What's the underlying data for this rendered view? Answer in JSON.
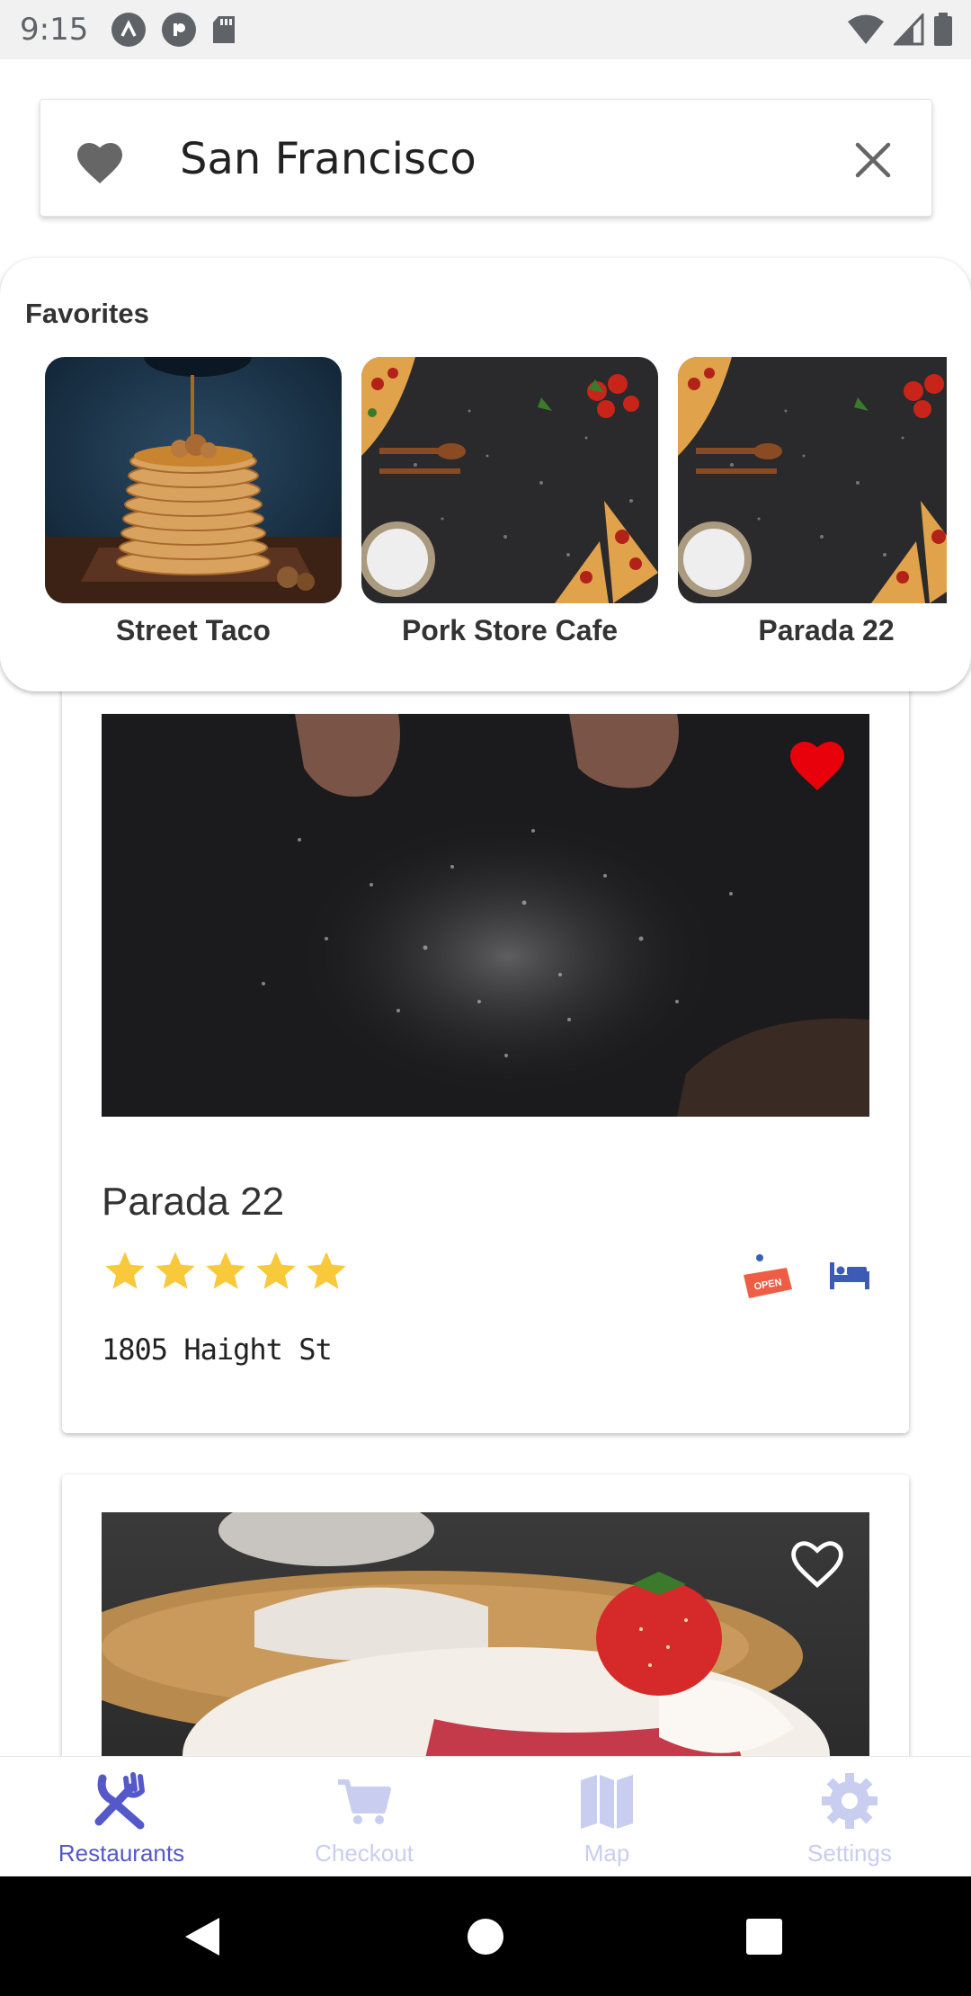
{
  "status_bar": {
    "time": "9:15"
  },
  "search": {
    "query": "San Francisco"
  },
  "favorites": {
    "title": "Favorites",
    "items": [
      {
        "name": "Street Taco"
      },
      {
        "name": "Pork Store Cafe"
      },
      {
        "name": "Parada 22"
      }
    ]
  },
  "restaurants": [
    {
      "name": "Parada 22",
      "rating": 5,
      "address": "1805 Haight St",
      "favorited": true,
      "open_badge": "OPEN"
    },
    {
      "favorited": false
    }
  ],
  "bottom_nav": {
    "tabs": [
      {
        "label": "Restaurants",
        "active": true
      },
      {
        "label": "Checkout"
      },
      {
        "label": "Map"
      },
      {
        "label": "Settings"
      }
    ]
  },
  "colors": {
    "accent": "#5558c8",
    "inactive_tab": "#c9cdf0",
    "favorite_red": "#e8000b",
    "star": "#f8c93a",
    "open_badge": "#ee5d45",
    "bed_icon": "#3d5bb5"
  },
  "icons": {
    "search_left": "heart-icon",
    "search_right": "close-icon",
    "restaurant_amenities": [
      "open-sign-icon",
      "bed-icon"
    ],
    "nav": [
      "fork-knife-icon",
      "cart-icon",
      "map-icon",
      "gear-icon"
    ]
  }
}
